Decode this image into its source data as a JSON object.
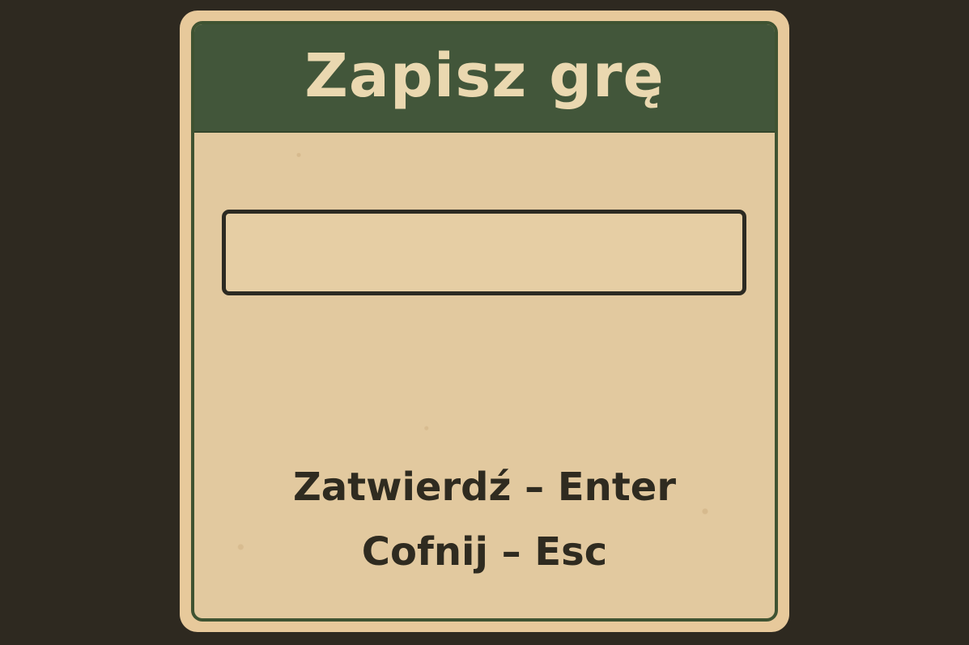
{
  "dialog": {
    "title": "Zapisz grę",
    "input": {
      "value": "",
      "placeholder": ""
    },
    "hints": {
      "confirm": "Zatwierdź – Enter",
      "cancel": "Cofnij – Esc"
    }
  },
  "colors": {
    "background": "#2e2920",
    "frame": "#e7c99b",
    "panel": "#e2c99f",
    "title_bar": "#42563a",
    "title_text": "#ead8b0",
    "border": "#3f5332",
    "text": "#2f2b20"
  }
}
